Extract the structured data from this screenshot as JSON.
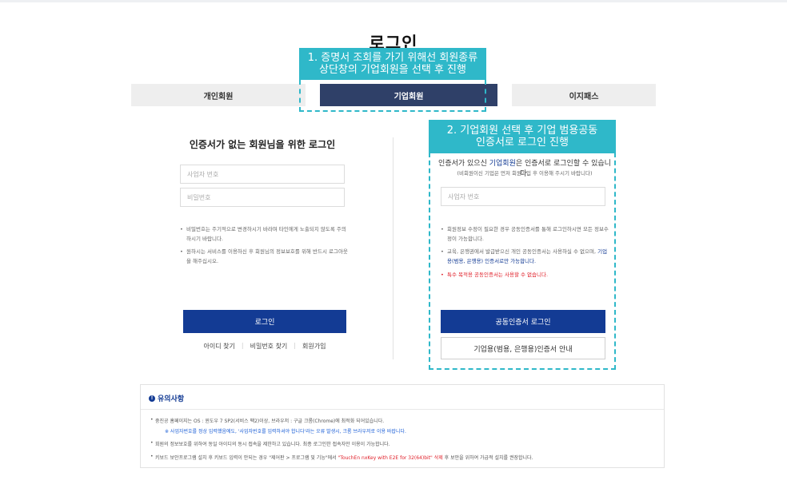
{
  "page": {
    "title": "로그인"
  },
  "annotations": {
    "step1_line1": "1. 증명서 조회를 가기 위해선 회원종류",
    "step1_line2": "상단창의 기업회원을 선택 후 진행",
    "step2_line1": "2. 기업회원 선택 후 기업 범용공동",
    "step2_line2": "인증서로 로그인 진행"
  },
  "tabs": [
    {
      "label": "개인회원",
      "active": false
    },
    {
      "label": "기업회원",
      "active": true
    },
    {
      "label": "이지패스",
      "active": false
    }
  ],
  "left": {
    "title": "인증서가 없는 회원님을 위한 로그인",
    "biz_placeholder": "사업자 번호",
    "pw_placeholder": "비밀번호",
    "note1": "비밀번호는 주기적으로 변경하시기 바라며 타인에게 노출되지 않도록 주의하시기 바랍니다.",
    "note2": "원하시는 서비스를 이용하신 후 회원님의 정보보호를 위해 반드시 로그아웃을 해주십시오.",
    "login_button": "로그인",
    "links": [
      "아이디 찾기",
      "비밀번호 찾기",
      "회원가입"
    ]
  },
  "right": {
    "desc_pre": "인증서가 있으신 ",
    "desc_hl": "기업회원",
    "desc_post": "은 인증서로 로그인할 수 있습니다.",
    "desc_sub": "(비회원이신 기업은 먼저 회원가입 후 이용해 주시기 바랍니다)",
    "biz_placeholder": "사업자 번호",
    "note1": "회원정보 수정이 필요한 경우 공동인증서를 통해 로그인하시면 모든 정보수정이 가능합니다.",
    "note2_pre": "교육, 은행권에서 발급받으신 개인 공동인증서는 사용하실 수 없으며, ",
    "note2_hl": "기업용(범용, 은행용) 인증서로만 가능합니다.",
    "note3": "특수 목적용 공동인증서는 사용할 수 없습니다.",
    "cert_button": "공동인증서 로그인",
    "guide_button": "기업용(범용, 은행용)인증서 안내"
  },
  "notice": {
    "title": "유의사항",
    "line1": "중진공 홈페이지는 OS : 윈도우 7 SP2(서비스 팩2)이상, 브라우저 : 구글 크롬(Chrome)에 최적화 되어있습니다.",
    "line1_sub": "※ 사업자번호를 정상 입력했음에도, '사업자번호를 입력하셔야 합니다'라는 오류 발생시, 크롬 브라우저로 이용 바랍니다.",
    "line2": "회원의 정보보호를 위하여 동일 아이디의 동시 접속을 제한하고 있습니다. 최종 로그인한 접속자만 이용이 가능합니다.",
    "line3_pre": "키보드 보안프로그램 설치 후 키보드 입력이 안되는 경우 \"제어판 > 프로그램 및 기능\"에서 ",
    "line3_red": "\"TouchEn nxKey with E2E for 32(64)bit\" 삭제",
    "line3_post": " 후 보안을 위하여 가급적 설치를 권장합니다."
  },
  "colors": {
    "accent": "#133b94",
    "tab_active": "#2f4068",
    "callout": "#2fb8c9",
    "warning": "#e0202a"
  }
}
